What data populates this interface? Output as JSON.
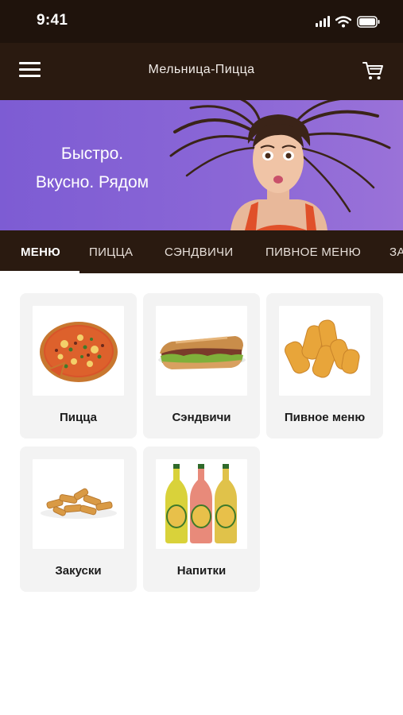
{
  "status_bar": {
    "time": "9:41",
    "icons": [
      "signal-icon",
      "wifi-icon",
      "battery-icon"
    ]
  },
  "header": {
    "title": "Мельница-Пицца",
    "menu_icon": "hamburger-menu-icon",
    "cart_icon": "cart-icon"
  },
  "banner": {
    "line1": "Быстро.",
    "line2": "Вкусно. Рядом",
    "background_color": "#8763d6"
  },
  "tabs": [
    {
      "label": "МЕНЮ",
      "active": true
    },
    {
      "label": "ПИЦЦА",
      "active": false
    },
    {
      "label": "СЭНДВИЧИ",
      "active": false
    },
    {
      "label": "ПИВНОЕ МЕНЮ",
      "active": false
    },
    {
      "label": "ЗА",
      "active": false
    }
  ],
  "categories": [
    {
      "label": "Пицца",
      "image": "pizza-image"
    },
    {
      "label": "Сэндвичи",
      "image": "sandwich-image"
    },
    {
      "label": "Пивное меню",
      "image": "fried-cheese-sticks-image"
    },
    {
      "label": "Закуски",
      "image": "croutons-image"
    },
    {
      "label": "Напитки",
      "image": "lemonade-bottles-image"
    }
  ],
  "colors": {
    "header_bg": "#2a1a10",
    "status_bg": "#1f130c",
    "card_bg": "#f3f3f3",
    "text": "#1c1c1c"
  }
}
